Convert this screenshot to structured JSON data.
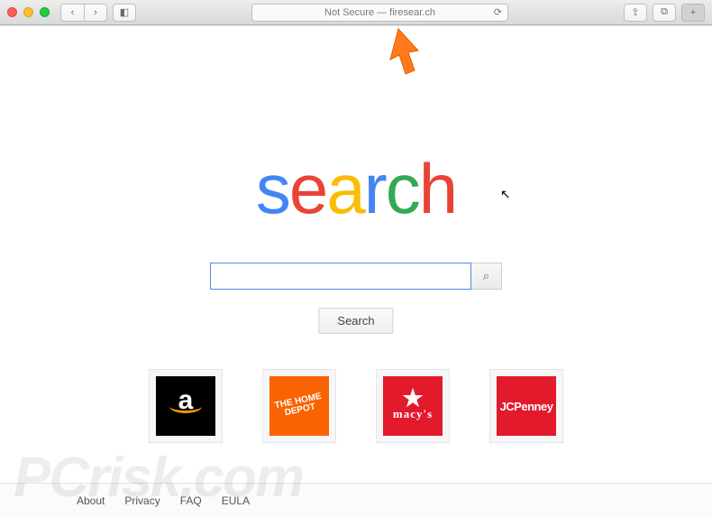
{
  "browser": {
    "address_text": "Not Secure — firesear.ch",
    "back_glyph": "‹",
    "forward_glyph": "›",
    "sidebar_glyph": "◧",
    "reload_glyph": "⟳",
    "share_glyph": "⇪",
    "tabs_glyph": "⧉",
    "plus_glyph": "+"
  },
  "logo": {
    "letters": [
      {
        "ch": "s",
        "color": "#4285f4"
      },
      {
        "ch": "e",
        "color": "#ea4335"
      },
      {
        "ch": "a",
        "color": "#fbbc05"
      },
      {
        "ch": "r",
        "color": "#4285f4"
      },
      {
        "ch": "c",
        "color": "#34a853"
      },
      {
        "ch": "h",
        "color": "#ea4335"
      }
    ]
  },
  "search": {
    "placeholder": "",
    "value": "",
    "button_label": "Search",
    "mag_glyph": "⌕"
  },
  "tiles": [
    {
      "name": "amazon"
    },
    {
      "name": "home-depot"
    },
    {
      "name": "macys"
    },
    {
      "name": "jcpenney",
      "label": "JCPenney"
    }
  ],
  "macys": {
    "star": "★",
    "text": "macy's"
  },
  "hd": {
    "text": "THE HOME DEPOT"
  },
  "footer": {
    "links": [
      "About",
      "Privacy",
      "FAQ",
      "EULA"
    ]
  },
  "watermark": "PCrisk.com"
}
